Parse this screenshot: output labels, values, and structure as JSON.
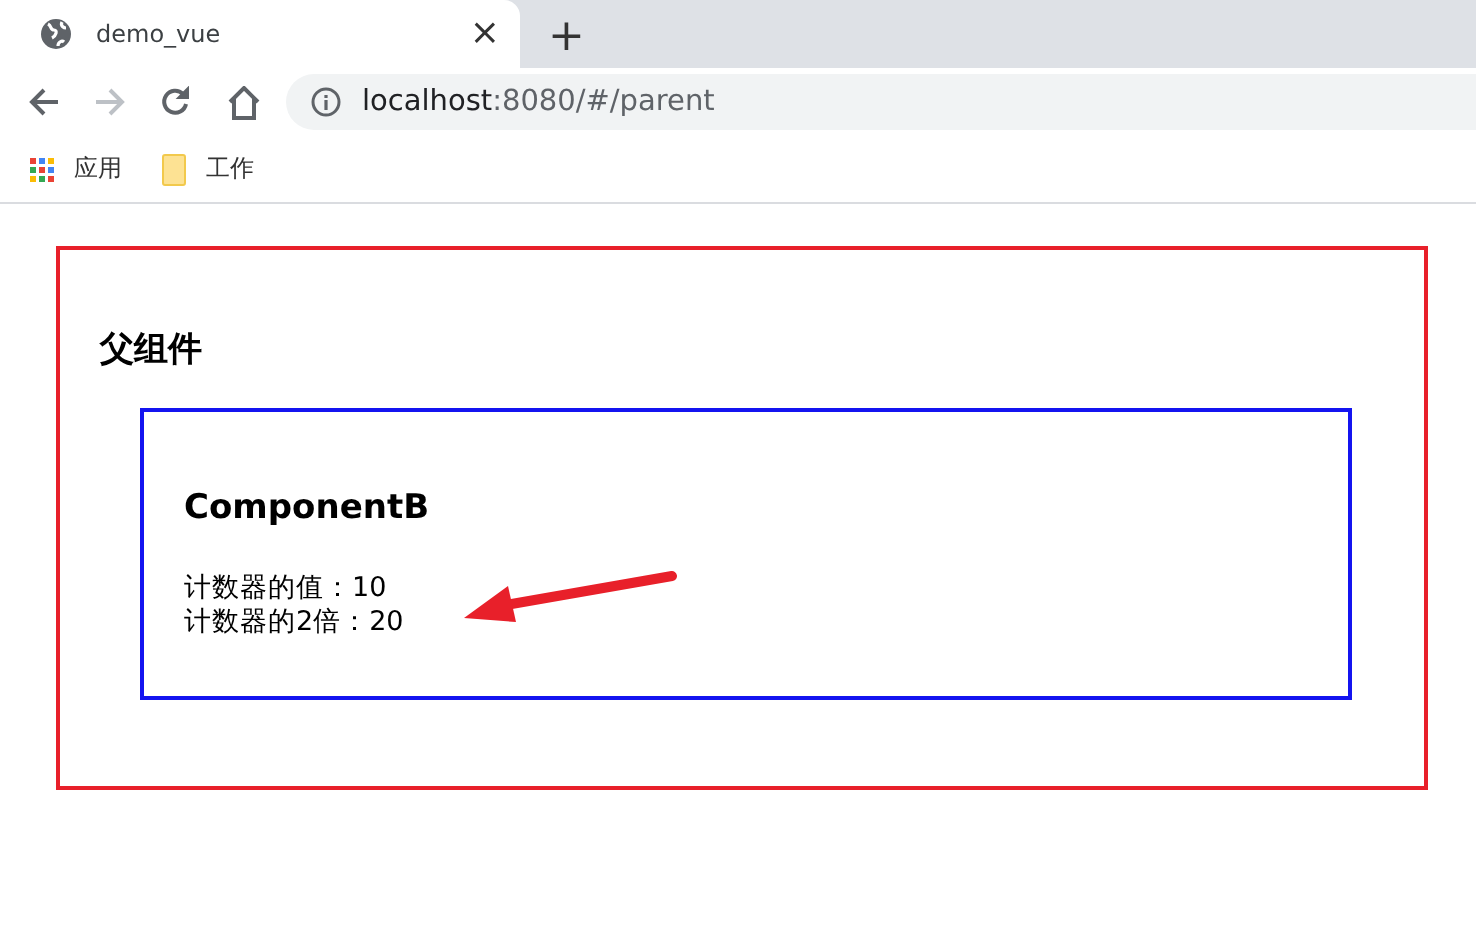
{
  "tab": {
    "title": "demo_vue",
    "close": "×",
    "new_tab": "+"
  },
  "nav": [
    {
      "kind": "back",
      "disabled": false
    },
    {
      "kind": "forward",
      "disabled": true
    },
    {
      "kind": "reload",
      "disabled": false
    },
    {
      "kind": "home",
      "disabled": false
    }
  ],
  "address": {
    "host": "localhost",
    "path": ":8080/#/parent"
  },
  "bookmarks": [
    {
      "kind": "apps",
      "label": "应用"
    },
    {
      "kind": "folder",
      "label": "工作"
    }
  ],
  "parent": {
    "title": "父组件",
    "child": {
      "title": "ComponentB",
      "lines": [
        "计数器的值：10",
        "计数器的2倍：20"
      ]
    }
  }
}
